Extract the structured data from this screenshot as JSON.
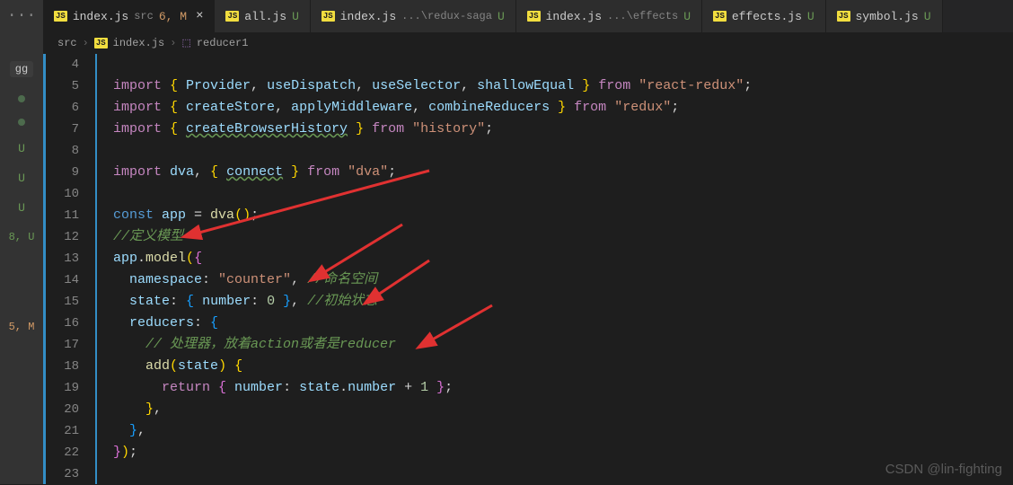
{
  "activity": {
    "dots": "···",
    "marker": "gg",
    "statuses": [
      "●",
      "●",
      "U",
      "U",
      "U",
      "8, U",
      "",
      "5, M"
    ]
  },
  "tabs": [
    {
      "name": "index.js",
      "suffix": "src",
      "status": "6, M",
      "active": true,
      "close": "×"
    },
    {
      "name": "all.js",
      "suffix": "",
      "status": "U"
    },
    {
      "name": "index.js",
      "suffix": "...\\redux-saga",
      "status": "U"
    },
    {
      "name": "index.js",
      "suffix": "...\\effects",
      "status": "U"
    },
    {
      "name": "effects.js",
      "suffix": "",
      "status": "U"
    },
    {
      "name": "symbol.js",
      "suffix": "",
      "status": "U"
    }
  ],
  "breadcrumb": {
    "seg1": "src",
    "seg2": "index.js",
    "seg3": "reducer1"
  },
  "lines": [
    "4",
    "5",
    "6",
    "7",
    "8",
    "9",
    "10",
    "11",
    "12",
    "13",
    "14",
    "15",
    "16",
    "17",
    "18",
    "19",
    "20",
    "21",
    "22",
    "23"
  ],
  "code": {
    "l5_import": "import ",
    "l5_Provider": "Provider",
    "l5_useDispatch": "useDispatch",
    "l5_useSelector": "useSelector",
    "l5_shallowEqual": "shallowEqual",
    "l5_from": " from ",
    "l5_pkg": "\"react-redux\"",
    "l6_createStore": "createStore",
    "l6_applyMiddleware": "applyMiddleware",
    "l6_combineReducers": "combineReducers",
    "l6_pkg": "\"redux\"",
    "l7_createBrowserHistory": "createBrowserHistory",
    "l7_pkg": "\"history\"",
    "l9_dva": "dva",
    "l9_connect": "connect",
    "l9_pkg": "\"dva\"",
    "l11_const": "const ",
    "l11_app": "app",
    "l11_eq": " = ",
    "l11_dvacall": "dva",
    "l12_comment": "//定义模型",
    "l13_app": "app",
    "l13_model": "model",
    "l14_ns": "namespace",
    "l14_val": "\"counter\"",
    "l14_comment": "//命名空间",
    "l15_state": "state",
    "l15_number": "number",
    "l15_zero": "0",
    "l15_comment": "//初始状态",
    "l16_reducers": "reducers",
    "l17_comment": "// 处理器，放着action或者是reducer",
    "l18_add": "add",
    "l18_state": "state",
    "l19_return": "return ",
    "l19_number": "number",
    "l19_state": "state",
    "l19_numberprop": "number",
    "l19_plus": " + ",
    "l19_one": "1"
  },
  "watermark": "CSDN @lin-fighting"
}
